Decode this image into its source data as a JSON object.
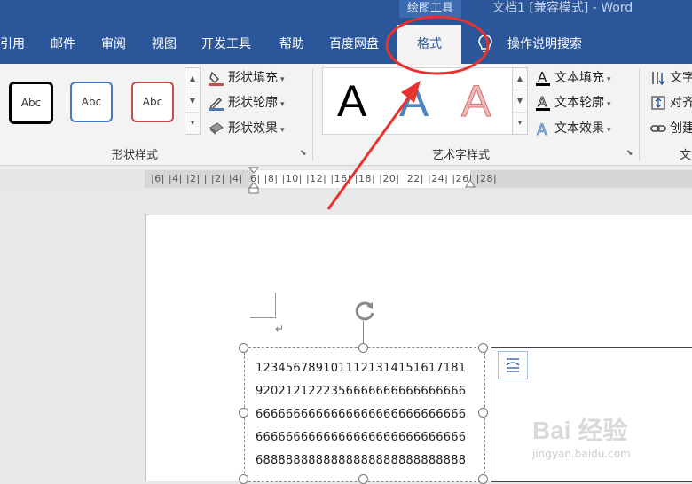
{
  "titlebar": {
    "context_tab_group": "绘图工具",
    "document_title": "文档1 [兼容模式] - Word"
  },
  "tabs": [
    {
      "label": "引用"
    },
    {
      "label": "邮件"
    },
    {
      "label": "审阅"
    },
    {
      "label": "视图"
    },
    {
      "label": "开发工具"
    },
    {
      "label": "帮助"
    },
    {
      "label": "百度网盘"
    },
    {
      "label": "格式",
      "active": true
    }
  ],
  "tell_me": {
    "label": "操作说明搜索",
    "icon": "lightbulb-icon"
  },
  "ribbon": {
    "shape_styles": {
      "thumbnails": [
        {
          "label": "Abc",
          "color": "#000000"
        },
        {
          "label": "Abc",
          "color": "#4a7ab8"
        },
        {
          "label": "Abc",
          "color": "#c0504d"
        }
      ],
      "fill_label": "形状填充",
      "outline_label": "形状轮廓",
      "effects_label": "形状效果",
      "group_label": "形状样式"
    },
    "wordart_styles": {
      "samples": [
        {
          "label": "A",
          "color": "#000000"
        },
        {
          "label": "A",
          "color": "#4f81bd"
        },
        {
          "label": "A",
          "color": "#f2b8b8"
        }
      ],
      "text_fill_label": "文本填充",
      "text_outline_label": "文本轮廓",
      "text_effects_label": "文本效果",
      "group_label": "艺术字样式"
    },
    "text_group": {
      "text_direction_label": "文字",
      "align_label": "对齐",
      "link_label": "创建",
      "group_label": "文"
    }
  },
  "ruler": {
    "labels": "|6|  |4|  |2|   |   |2|  |4|  |6|  |8| |10| |12|      |16| |18| |20| |22| |24| |26| |28|"
  },
  "document": {
    "textbox_lines": [
      "1234567891011121314151617181",
      "9202121222356666666666666666",
      "6666666666666666666666666666",
      "6666666666666666666666666666",
      "6888888888888888888888888888"
    ]
  },
  "watermark": {
    "brand": "Bai 经验",
    "url": "jingyan.baidu.com"
  },
  "colors": {
    "ribbon_blue": "#2b579a",
    "annotation_red": "#e8322e"
  }
}
